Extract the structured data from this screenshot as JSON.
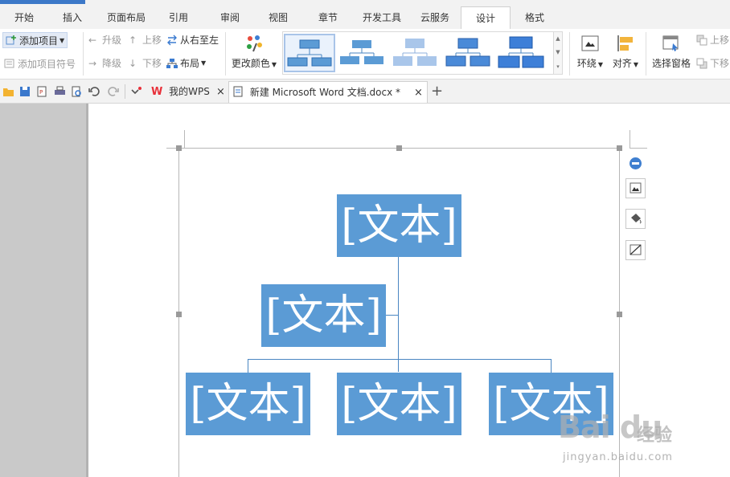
{
  "menu_tabs": [
    "开始",
    "插入",
    "页面布局",
    "引用",
    "审阅",
    "视图",
    "章节",
    "开发工具",
    "云服务",
    "设计",
    "格式"
  ],
  "ribbon": {
    "add_item": "添加项目",
    "add_item_bullet": "添加项目符号",
    "promote": "升级",
    "demote": "降级",
    "move_up": "上移",
    "move_down": "下移",
    "right_to_left": "从右至左",
    "layout": "布局",
    "change_colors": "更改颜色",
    "wrap": "环绕",
    "align": "对齐",
    "selection_pane": "选择窗格",
    "bring_forward": "上移",
    "send_backward": "下移"
  },
  "doc_tabs": {
    "my_wps": "我的WPS",
    "document": "新建 Microsoft Word 文档.docx *",
    "close": "×",
    "new_tab": "+"
  },
  "smartart": {
    "top": "[文本]",
    "assistant": "[文本]",
    "child1": "[文本]",
    "child2": "[文本]",
    "child3": "[文本]"
  },
  "watermark": {
    "brand": "Bai du",
    "sub": "经验",
    "url": "jingyan.baidu.com"
  },
  "colors": {
    "node_fill": "#5b9bd5",
    "connector": "#4a86c2",
    "accent": "#3c78c8"
  }
}
